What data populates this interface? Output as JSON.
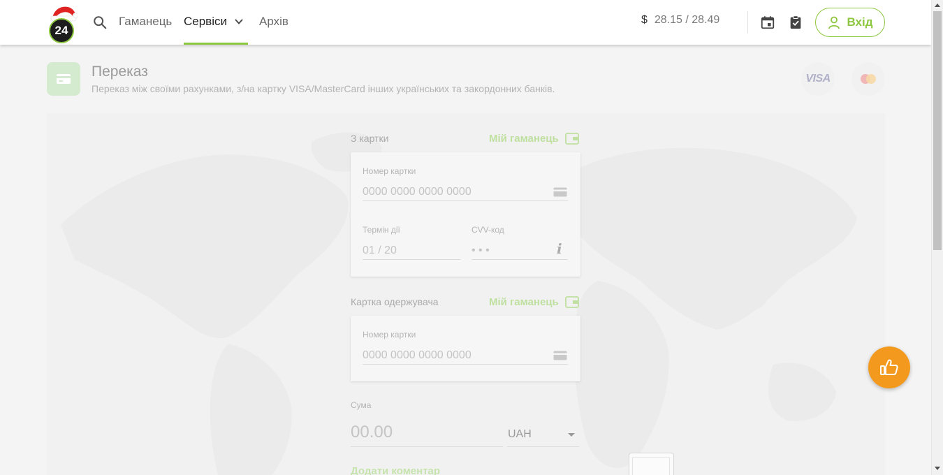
{
  "header": {
    "logo_text": "24",
    "nav": [
      {
        "label": "Гаманець"
      },
      {
        "label": "Сервіси"
      },
      {
        "label": "Архів"
      }
    ],
    "currency_symbol": "$",
    "rate": "28.15 / 28.49",
    "login_label": "Вхід",
    "accent_color": "#8dc63f"
  },
  "page": {
    "title": "Переказ",
    "subtitle": "Переказ між своїми рахунками, з/на картку VISA/MasterCard інших українських та закордонних банків.",
    "brand_visa": "VISA"
  },
  "from_card": {
    "heading": "З картки",
    "wallet_link": "Мій гаманець",
    "number_label": "Номер картки",
    "number_placeholder": "0000 0000 0000 0000",
    "expiry_label": "Термін дії",
    "expiry_placeholder": "01 / 20",
    "cvv_label": "CVV-код",
    "cvv_placeholder": "• • •",
    "info_symbol": "i"
  },
  "to_card": {
    "heading": "Картка одержувача",
    "wallet_link": "Мій гаманець",
    "number_label": "Номер картки",
    "number_placeholder": "0000 0000 0000 0000"
  },
  "amount": {
    "label": "Сума",
    "placeholder": "00.00",
    "currency": "UAH"
  },
  "add_comment": "Додати коментар",
  "fab_color": "#f39a1e"
}
